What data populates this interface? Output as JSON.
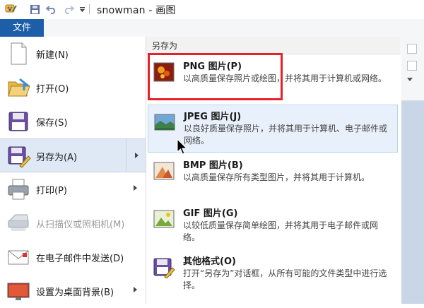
{
  "window": {
    "title": "snowman - 画图"
  },
  "file_tab": {
    "label": "文件"
  },
  "left_menu": [
    {
      "label": "新建(N)",
      "icon": "new-document-icon",
      "disabled": false
    },
    {
      "label": "打开(O)",
      "icon": "open-folder-icon",
      "disabled": false
    },
    {
      "label": "保存(S)",
      "icon": "save-disk-icon",
      "disabled": false
    },
    {
      "label": "另存为(A)",
      "icon": "save-as-icon",
      "disabled": false,
      "submenu": true,
      "active": true
    },
    {
      "label": "打印(P)",
      "icon": "printer-icon",
      "disabled": false,
      "submenu": true
    },
    {
      "label": "从扫描仪或照相机(M)",
      "icon": "scanner-icon",
      "disabled": true
    },
    {
      "label": "在电子邮件中发送(D)",
      "icon": "email-icon",
      "disabled": false
    },
    {
      "label": "设置为桌面背景(B)",
      "icon": "desktop-background-icon",
      "disabled": false,
      "submenu": true
    }
  ],
  "save_as_panel": {
    "header": "另存为",
    "items": [
      {
        "title": "PNG 图片(P)",
        "desc": "以高质量保存照片或绘图，并将其用于计算机或网络。",
        "icon": "png-image-icon"
      },
      {
        "title": "JPEG 图片(J)",
        "desc": "以良好质量保存照片，并将其用于计算机、电子邮件或网络。",
        "icon": "jpeg-image-icon"
      },
      {
        "title": "BMP 图片(B)",
        "desc": "以高质量保存所有类型图片，并将其用于计算机。",
        "icon": "bmp-image-icon"
      },
      {
        "title": "GIF 图片(G)",
        "desc": "以较低质量保存简单绘图，并将其用于电子邮件或网络。",
        "icon": "gif-image-icon"
      },
      {
        "title": "其他格式(O)",
        "desc": "打开“另存为”对话框，从所有可能的文件类型中进行选择。",
        "icon": "other-formats-icon"
      }
    ]
  },
  "colors": {
    "file_tab": "#1c5fa8",
    "highlight": "#e3222b",
    "active_item": "#dfe8f5"
  }
}
